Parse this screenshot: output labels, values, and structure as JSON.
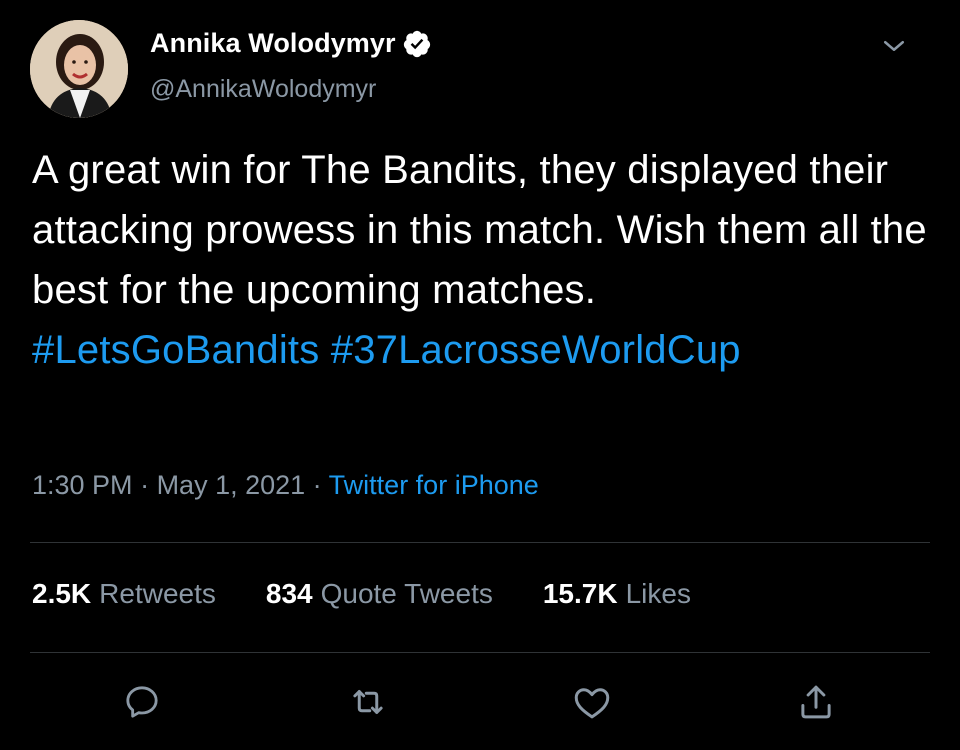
{
  "user": {
    "display_name": "Annika Wolodymyr",
    "handle": "@AnnikaWolodymyr",
    "verified": true
  },
  "tweet": {
    "text": "A great win for The Bandits, they displayed their attacking prowess in this match. Wish them all the best for the upcoming matches.",
    "hashtags": [
      "#LetsGoBandits",
      "#37LacrosseWorldCup"
    ]
  },
  "meta": {
    "time": "1:30 PM",
    "separator": " · ",
    "date": "May 1, 2021",
    "source": "Twitter for iPhone"
  },
  "stats": {
    "retweets": {
      "count": "2.5K",
      "label": "Retweets"
    },
    "quotes": {
      "count": "834",
      "label": "Quote Tweets"
    },
    "likes": {
      "count": "15.7K",
      "label": "Likes"
    }
  },
  "actions": [
    {
      "icon": "reply-icon"
    },
    {
      "icon": "retweet-icon"
    },
    {
      "icon": "like-icon"
    },
    {
      "icon": "share-icon"
    }
  ],
  "colors": {
    "background": "#000000",
    "text": "#ffffff",
    "secondary": "#8b98a5",
    "accent": "#1d9bf0",
    "divider": "#2f3336"
  }
}
